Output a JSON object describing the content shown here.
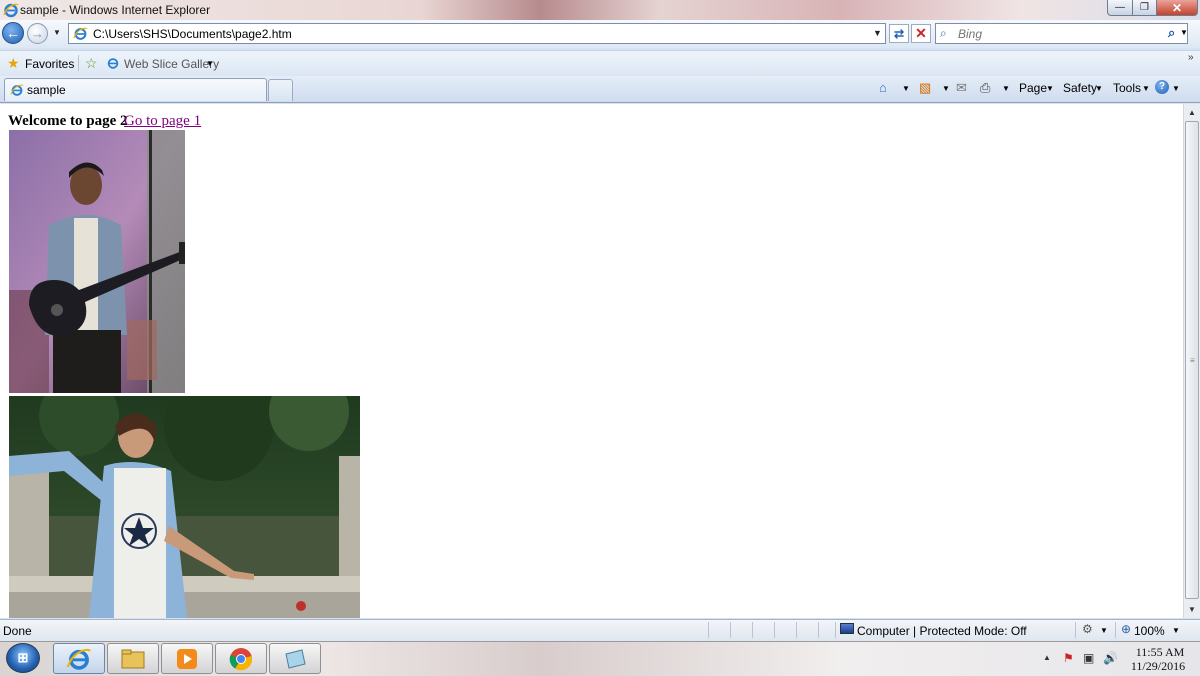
{
  "window": {
    "title": "sample - Windows Internet Explorer",
    "controls": {
      "minimize": "—",
      "maximize": "❐",
      "close": "✕"
    }
  },
  "navigation": {
    "address": "C:\\Users\\SHS\\Documents\\page2.htm",
    "search_placeholder": "Bing"
  },
  "favorites_bar": {
    "favorites_label": "Favorites",
    "web_slice_label": "Web Slice Gallery"
  },
  "tabs": [
    {
      "label": "sample",
      "active": true
    }
  ],
  "command_bar": {
    "page_label": "Page",
    "safety_label": "Safety",
    "tools_label": "Tools"
  },
  "page": {
    "heading": "Welcome to page 2",
    "link": "Go to page 1",
    "images": [
      {
        "name": "guitarist-photo",
        "description": "man playing electric guitar on stage"
      },
      {
        "name": "outdoor-photo",
        "description": "woman leaning on stone railing by a pond"
      }
    ]
  },
  "status_bar": {
    "status": "Done",
    "zone": "Computer | Protected Mode: Off",
    "zoom": "100%"
  },
  "taskbar": {
    "apps": [
      "internet-explorer",
      "file-explorer",
      "media-player",
      "chrome",
      "notepad"
    ],
    "clock_time": "11:55 AM",
    "clock_date": "11/29/2016"
  },
  "colors": {
    "link_visited": "#800080",
    "chrome_blue": "#d7e3f1",
    "close_red": "#c3422f"
  }
}
